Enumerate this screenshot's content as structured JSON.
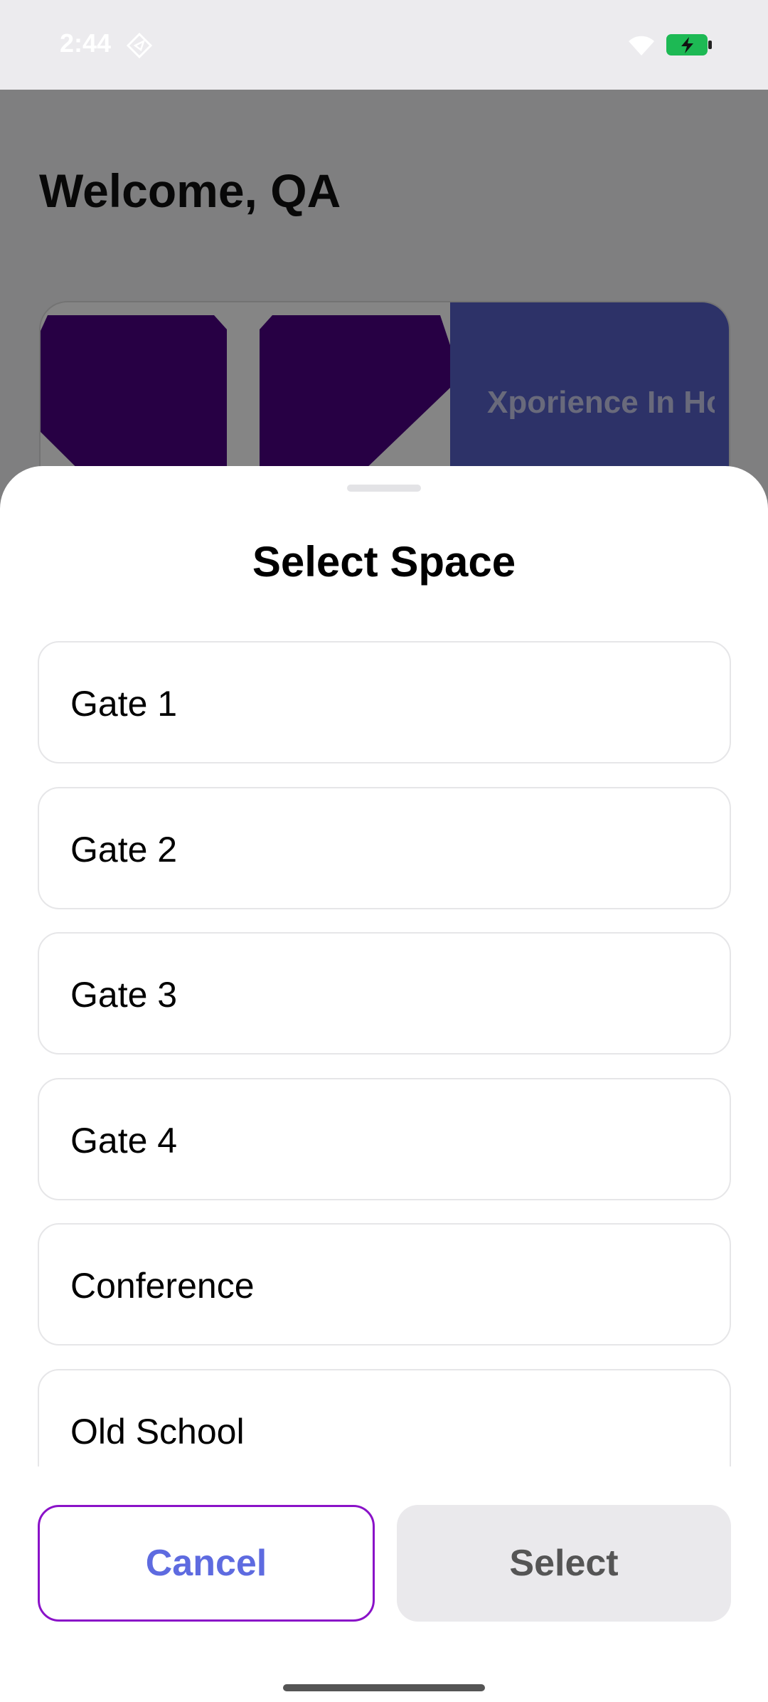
{
  "status_bar": {
    "time": "2:44",
    "icons": [
      "navigation-diamond-icon",
      "wifi-icon",
      "battery-charging-icon"
    ],
    "battery_color": "#1DB954"
  },
  "background": {
    "welcome": "Welcome, QA",
    "event_card": {
      "title": "Xporience In House E...",
      "logo": "purple-y-logo",
      "logo_color": "#4B0082",
      "side_color": "#5660C8"
    }
  },
  "sheet": {
    "title": "Select Space",
    "options": [
      {
        "label": "Gate 1"
      },
      {
        "label": "Gate 2"
      },
      {
        "label": "Gate 3"
      },
      {
        "label": "Gate 4"
      },
      {
        "label": "Conference"
      },
      {
        "label": "Old School"
      }
    ],
    "cancel_label": "Cancel",
    "select_label": "Select",
    "colors": {
      "cancel_border": "#8A12C8",
      "cancel_text": "#5E6BE0",
      "select_bg": "#EAE9EC"
    }
  }
}
